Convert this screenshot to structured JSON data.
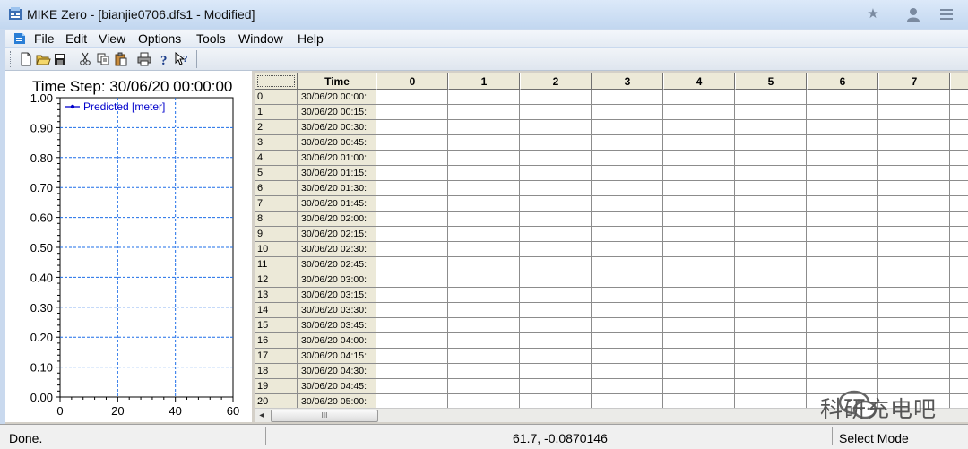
{
  "window": {
    "title": "MIKE Zero - [bianjie0706.dfs1 - Modified]",
    "app_icon": "mike-zero-icon"
  },
  "titlebar_buttons": [
    {
      "icon": "star-icon"
    },
    {
      "icon": "user-icon"
    },
    {
      "icon": "menu-lines-icon"
    }
  ],
  "menu": {
    "icon": "document-doc-icon",
    "items": [
      "File",
      "Edit",
      "View",
      "Options",
      "Tools",
      "Window",
      "Help"
    ]
  },
  "toolbar": {
    "items": [
      {
        "icon": "new-file-icon"
      },
      {
        "icon": "open-folder-icon"
      },
      {
        "icon": "save-icon"
      },
      {
        "icon": "cut-icon"
      },
      {
        "icon": "copy-icon"
      },
      {
        "icon": "paste-icon"
      },
      {
        "icon": "print-icon"
      },
      {
        "icon": "help-icon"
      },
      {
        "icon": "context-help-icon"
      }
    ]
  },
  "chart_data": {
    "type": "line",
    "title": "Time Step: 30/06/20 00:00:00",
    "legend": [
      {
        "name": "Predicted [meter]",
        "color": "#0000cc"
      }
    ],
    "series": [
      {
        "name": "Predicted [meter]",
        "values": []
      }
    ],
    "xlim": [
      0,
      60
    ],
    "ylim": [
      0,
      1
    ],
    "xticks": [
      "0",
      "20",
      "40",
      "60"
    ],
    "yticks": [
      "0.00",
      "0.10",
      "0.20",
      "0.30",
      "0.40",
      "0.50",
      "0.60",
      "0.70",
      "0.80",
      "0.90",
      "1.00"
    ],
    "grid": true,
    "legend_position": "top-left"
  },
  "grid": {
    "time_header": "Time",
    "columns": [
      "0",
      "1",
      "2",
      "3",
      "4",
      "5",
      "6",
      "7"
    ],
    "rows": [
      {
        "index": "0",
        "time": "30/06/20 00:00:"
      },
      {
        "index": "1",
        "time": "30/06/20 00:15:"
      },
      {
        "index": "2",
        "time": "30/06/20 00:30:"
      },
      {
        "index": "3",
        "time": "30/06/20 00:45:"
      },
      {
        "index": "4",
        "time": "30/06/20 01:00:"
      },
      {
        "index": "5",
        "time": "30/06/20 01:15:"
      },
      {
        "index": "6",
        "time": "30/06/20 01:30:"
      },
      {
        "index": "7",
        "time": "30/06/20 01:45:"
      },
      {
        "index": "8",
        "time": "30/06/20 02:00:"
      },
      {
        "index": "9",
        "time": "30/06/20 02:15:"
      },
      {
        "index": "10",
        "time": "30/06/20 02:30:"
      },
      {
        "index": "11",
        "time": "30/06/20 02:45:"
      },
      {
        "index": "12",
        "time": "30/06/20 03:00:"
      },
      {
        "index": "13",
        "time": "30/06/20 03:15:"
      },
      {
        "index": "14",
        "time": "30/06/20 03:30:"
      },
      {
        "index": "15",
        "time": "30/06/20 03:45:"
      },
      {
        "index": "16",
        "time": "30/06/20 04:00:"
      },
      {
        "index": "17",
        "time": "30/06/20 04:15:"
      },
      {
        "index": "18",
        "time": "30/06/20 04:30:"
      },
      {
        "index": "19",
        "time": "30/06/20 04:45:"
      },
      {
        "index": "20",
        "time": "30/06/20 05:00:"
      }
    ]
  },
  "scrollbar": {
    "left_arrow": "◄",
    "thumb_grip": "III"
  },
  "status": {
    "message": "Done.",
    "coordinates": "61.7, -0.0870146",
    "mode": "Select Mode"
  },
  "watermark": {
    "text": "科研充电吧",
    "icon": "wechat-icon"
  },
  "colors": {
    "series": "#0000cc",
    "grid_line": "#1e6fe8",
    "frame": "#000000"
  }
}
